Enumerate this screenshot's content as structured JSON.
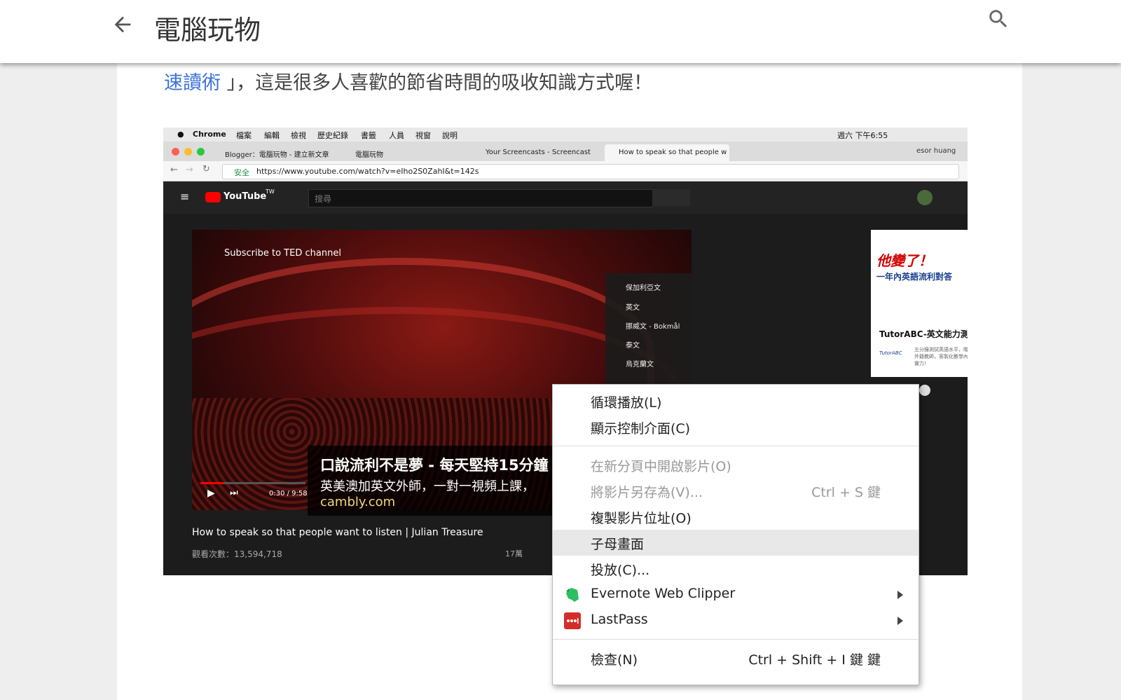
{
  "topbar": {
    "title": "電腦玩物"
  },
  "intro": {
    "link_text": "速讀術",
    "rest_text": "」，這是很多人喜歡的節省時間的吸收知識方式喔！"
  },
  "screenshot": {
    "mac_menu": [
      "Chrome",
      "檔案",
      "編輯",
      "檢視",
      "歷史紀錄",
      "書籤",
      "人員",
      "視窗",
      "說明"
    ],
    "clock": "週六 下午6:55",
    "tabs": [
      {
        "label": "Blogger：電腦玩物 - 建立新文章"
      },
      {
        "label": "電腦玩物"
      },
      {
        "label": "Your Screencasts - Screencast"
      },
      {
        "label": "How to speak so that people w"
      }
    ],
    "profile": "esor huang",
    "secure_label": "安全",
    "url": "https://www.youtube.com/watch?v=eIho2S0ZahI&t=142s",
    "youtube": {
      "logo": "YouTube",
      "logo_suffix": "TW",
      "search_placeholder": "搜尋",
      "subscribe_text": "Subscribe to TED channel",
      "subtitle_languages": [
        "保加利亞文",
        "英文",
        "挪威文 - Bokmål",
        "泰文",
        "烏克蘭文"
      ],
      "ad": {
        "headline": "他變了！",
        "subheadline": "一年內英語流利對答",
        "title": "TutorABC-英文能力測驗",
        "brand": "TutorABC",
        "desc": "五分鐘測試英語水平，贈送評估報告，精準配對外籍教師，客製化教學內容，輕鬆重建你的英語實力！"
      },
      "caption": {
        "line1": "口說流利不是夢 - 每天堅持15分鐘",
        "line2": "英美澳加英文外師，一對一視頻上課，",
        "link": "cambly.com"
      },
      "time": "0:30 / 9:58",
      "video_title": "How to speak so that people want to listen | Julian Treasure",
      "views": "觀看次數：13,594,718",
      "likes": "17萬"
    }
  },
  "context_menu": {
    "items": [
      {
        "label": "循環播放(L)",
        "shortcut": "",
        "disabled": false
      },
      {
        "label": "顯示控制介面(C)",
        "shortcut": "",
        "disabled": false
      },
      {
        "label": "在新分頁中開啟影片(O)",
        "shortcut": "",
        "disabled": true
      },
      {
        "label": "將影片另存為(V)...",
        "shortcut": "Ctrl + S 鍵",
        "disabled": true
      },
      {
        "label": "複製影片位址(O)",
        "shortcut": "",
        "disabled": false
      },
      {
        "label": "子母畫面",
        "shortcut": "",
        "disabled": false
      },
      {
        "label": "投放(C)...",
        "shortcut": "",
        "disabled": false
      },
      {
        "label": "Evernote Web Clipper",
        "shortcut": "",
        "disabled": false
      },
      {
        "label": "LastPass",
        "shortcut": "",
        "disabled": false
      },
      {
        "label": "檢查(N)",
        "shortcut": "Ctrl + Shift + I 鍵 鍵",
        "disabled": false
      }
    ],
    "highlighted_index": 5
  },
  "colors": {
    "link": "#3b73d9",
    "menu_highlight": "#e8e8e8",
    "evernote": "#2dbe60",
    "lastpass": "#d32d27",
    "youtube_red": "#ff0000"
  }
}
